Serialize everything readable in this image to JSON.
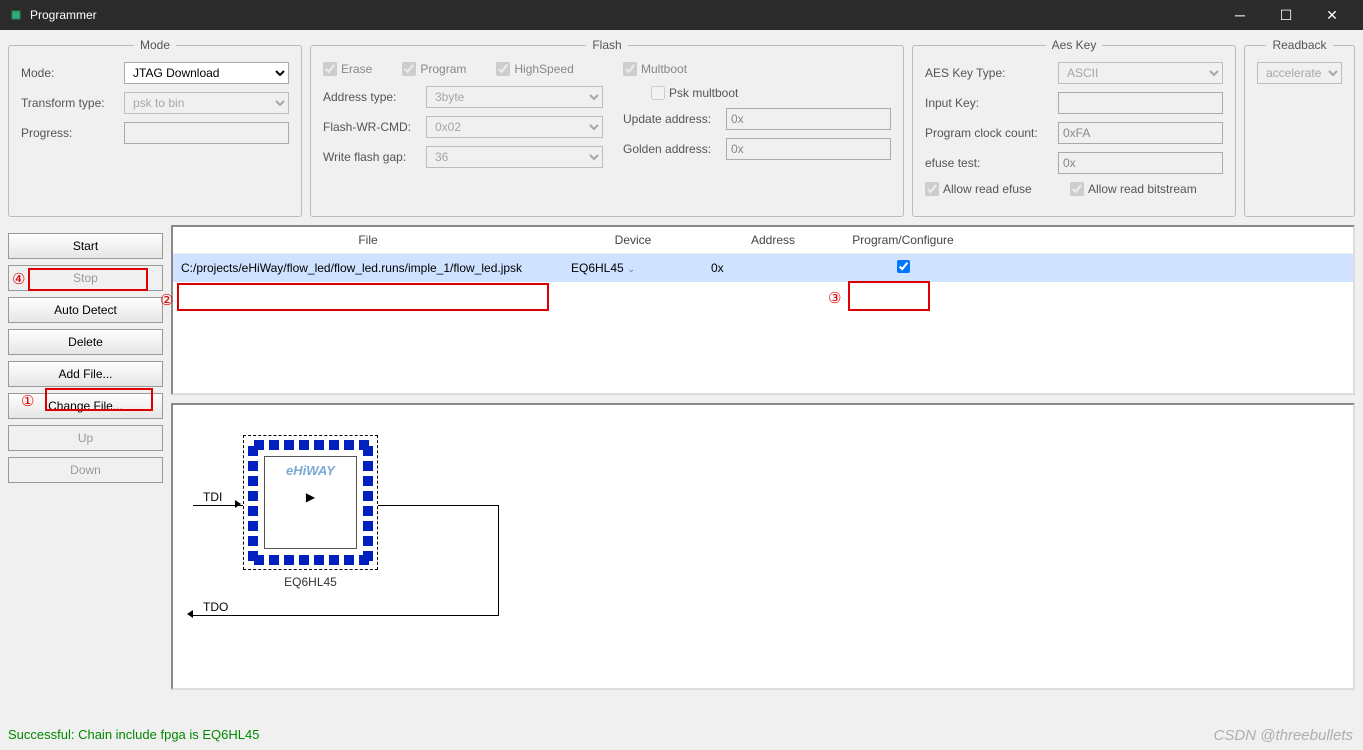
{
  "window": {
    "title": "Programmer"
  },
  "mode_panel": {
    "legend": "Mode",
    "mode_label": "Mode:",
    "mode_value": "JTAG Download",
    "transform_label": "Transform type:",
    "transform_value": "psk to bin",
    "progress_label": "Progress:"
  },
  "flash_panel": {
    "legend": "Flash",
    "erase": "Erase",
    "program": "Program",
    "highspeed": "HighSpeed",
    "multboot": "Multboot",
    "address_type_label": "Address type:",
    "address_type_value": "3byte",
    "psk_multboot": "Psk multboot",
    "flash_wr_cmd_label": "Flash-WR-CMD:",
    "flash_wr_cmd_value": "0x02",
    "update_addr_label": "Update address:",
    "update_addr_value": "0x",
    "write_flash_gap_label": "Write flash gap:",
    "write_flash_gap_value": "36",
    "golden_addr_label": "Golden address:",
    "golden_addr_value": "0x"
  },
  "aes_panel": {
    "legend": "Aes Key",
    "key_type_label": "AES Key Type:",
    "key_type_value": "ASCII",
    "input_key_label": "Input Key:",
    "clock_count_label": "Program clock count:",
    "clock_count_value": "0xFA",
    "efuse_test_label": "efuse test:",
    "efuse_test_value": "0x",
    "allow_read_efuse": "Allow read efuse",
    "allow_read_bitstream": "Allow read bitstream"
  },
  "readback_panel": {
    "legend": "Readback",
    "value": "accelerate"
  },
  "buttons": {
    "start": "Start",
    "stop": "Stop",
    "auto_detect": "Auto Detect",
    "delete": "Delete",
    "add_file": "Add File...",
    "change_file": "Change File...",
    "up": "Up",
    "down": "Down"
  },
  "table": {
    "headers": {
      "file": "File",
      "device": "Device",
      "address": "Address",
      "program": "Program/Configure"
    },
    "row": {
      "file": "C:/projects/eHiWay/flow_led/flow_led.runs/imple_1/flow_led.jpsk",
      "device": "EQ6HL45",
      "address": "0x",
      "program_checked": true
    }
  },
  "diagram": {
    "logo": "eHiWAY",
    "chip_name": "EQ6HL45",
    "tdi": "TDI",
    "tdo": "TDO"
  },
  "status": "Successful: Chain include fpga is EQ6HL45",
  "watermark": "CSDN @threebullets",
  "annotations": {
    "a1": "①",
    "a2": "②",
    "a3": "③",
    "a4": "④"
  }
}
